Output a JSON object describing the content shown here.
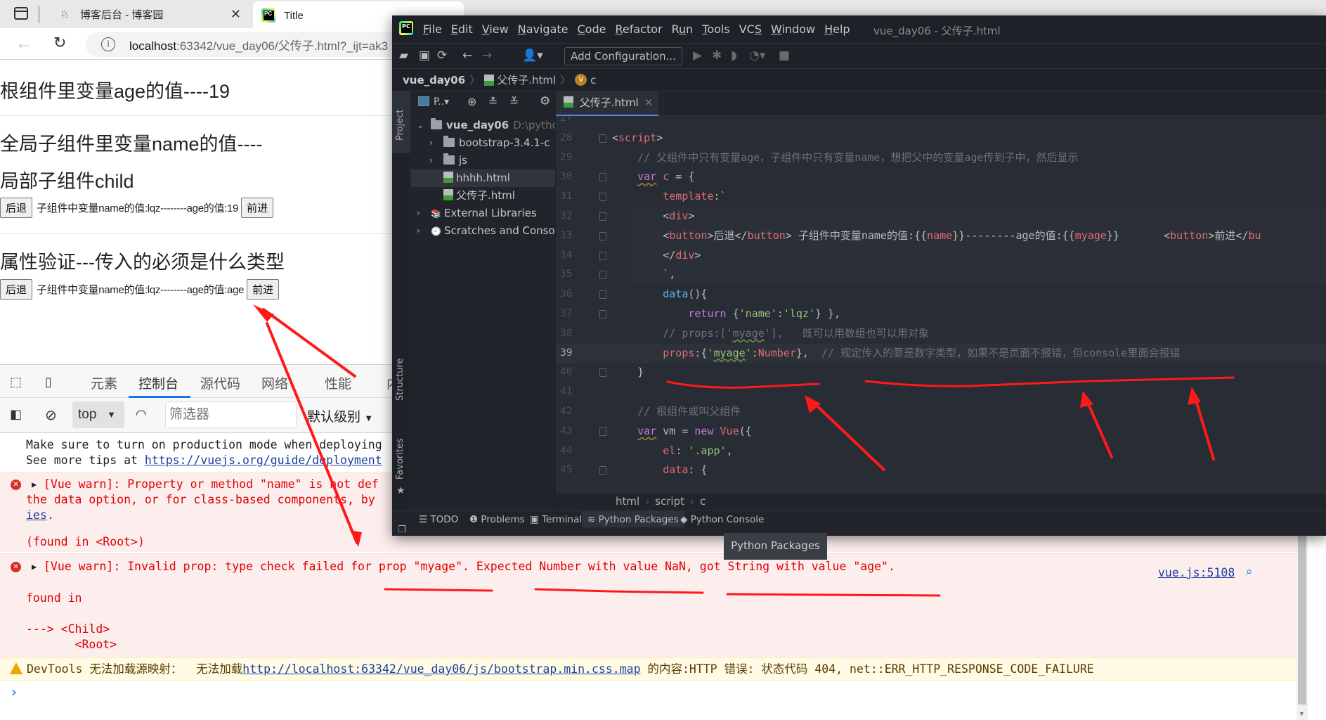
{
  "browser": {
    "tabs": [
      {
        "title": "博客后台 - 博客园",
        "icon": "cnblogs-icon",
        "active": false
      },
      {
        "title": "Title",
        "icon": "pycharm-icon",
        "active": true
      }
    ],
    "url_host": "localhost",
    "url_rest": ":63342/vue_day06/父传子.html?_ijt=ak3"
  },
  "page": {
    "heading_root": "根组件里变量age的值----19",
    "heading_global": "全局子组件里变量name的值----",
    "heading_local": "局部子组件child",
    "row1": {
      "back": "后退",
      "text": "子组件中变量name的值:lqz--------age的值:19",
      "forward": "前进"
    },
    "heading_validation": "属性验证---传入的必须是什么类型",
    "row2": {
      "back": "后退",
      "text": "子组件中变量name的值:lqz--------age的值:age",
      "forward": "前进"
    }
  },
  "devtools": {
    "tabs": [
      "元素",
      "控制台",
      "源代码",
      "网络",
      "性能",
      "内"
    ],
    "active_tab": "控制台",
    "context": "top",
    "filter_placeholder": "筛选器",
    "level": "默认级别",
    "console": {
      "info_line1": "Make sure to turn on production mode when deploying",
      "info_line2_prefix": "See more tips at ",
      "info_line2_link": "https://vuejs.org/guide/deployment",
      "err1_line1": "[Vue warn]: Property or method \"name\" is not def",
      "err1_line2": "the data option, or for class-based components, by",
      "err1_line3": "ies",
      "err1_line3_suffix": ".",
      "err1_found": "(found in <Root>)",
      "err2_line1": "[Vue warn]: Invalid prop: type check failed for prop \"myage\". Expected Number with value NaN, got String with value \"age\".",
      "err2_source": "vue.js:5108",
      "err2_found": "found in",
      "err2_child": "---> <Child>",
      "err2_root": "       <Root>",
      "warn_prefix": "DevTools 无法加载源映射：  无法加载",
      "warn_link": "http://localhost:63342/vue_day06/js/bootstrap.min.css.map",
      "warn_suffix": " 的内容:HTTP 错误: 状态代码 404, net::ERR_HTTP_RESPONSE_CODE_FAILURE",
      "prompt": "›"
    }
  },
  "ide": {
    "menu": [
      {
        "pre": "",
        "u": "F",
        "post": "ile"
      },
      {
        "pre": "",
        "u": "E",
        "post": "dit"
      },
      {
        "pre": "",
        "u": "V",
        "post": "iew"
      },
      {
        "pre": "",
        "u": "N",
        "post": "avigate"
      },
      {
        "pre": "",
        "u": "C",
        "post": "ode"
      },
      {
        "pre": "",
        "u": "R",
        "post": "efactor"
      },
      {
        "pre": "R",
        "u": "u",
        "post": "n"
      },
      {
        "pre": "",
        "u": "T",
        "post": "ools"
      },
      {
        "pre": "VC",
        "u": "S",
        "post": ""
      },
      {
        "pre": "",
        "u": "W",
        "post": "indow"
      },
      {
        "pre": "",
        "u": "H",
        "post": "elp"
      }
    ],
    "title": "vue_day06 - 父传子.html",
    "add_configuration": "Add Configuration...",
    "nav": {
      "project": "vue_day06",
      "file": "父传子.html",
      "symbol": "c"
    },
    "strip": {
      "project": "Project",
      "structure": "Structure",
      "favorites": "Favorites"
    },
    "project_header": "P..",
    "tree": [
      {
        "label": "vue_day06",
        "extra": "D:\\pytho",
        "type": "folder",
        "expanded": true
      },
      {
        "label": "bootstrap-3.4.1-c",
        "type": "folder",
        "expanded": false
      },
      {
        "label": "js",
        "type": "folder",
        "expanded": false
      },
      {
        "label": "hhhh.html",
        "type": "html",
        "selected": true
      },
      {
        "label": "父传子.html",
        "type": "html"
      },
      {
        "label": "External Libraries",
        "type": "lib",
        "expanded": false
      },
      {
        "label": "Scratches and Conso",
        "type": "scratch",
        "expanded": false
      }
    ],
    "editor_tab": "父传子.html",
    "current_line": 39,
    "code": [
      {
        "n": 27,
        "tokens": []
      },
      {
        "n": 28,
        "tokens": [
          [
            "t-punc",
            "<"
          ],
          [
            "t-tag",
            "script"
          ],
          [
            "t-punc",
            ">"
          ]
        ]
      },
      {
        "n": 29,
        "tokens": [
          [
            "t-cmt",
            "    // 父组件中只有变量age，子组件中只有变量name，想把父中的变量age传到子中，然后显示"
          ]
        ]
      },
      {
        "n": 30,
        "tokens": [
          [
            "t-mute",
            "    "
          ],
          [
            "t-kwu",
            "var"
          ],
          [
            "t-var",
            " c"
          ],
          [
            "t-punc",
            " = {"
          ]
        ]
      },
      {
        "n": 31,
        "tokens": [
          [
            "t-mute",
            "        "
          ],
          [
            "t-prop",
            "template"
          ],
          [
            "t-punc",
            ":"
          ],
          [
            "t-str",
            "`"
          ]
        ]
      },
      {
        "n": 32,
        "tokens": [
          [
            "t-mute",
            "        "
          ],
          [
            "t-punc",
            "<"
          ],
          [
            "t-tag",
            "div"
          ],
          [
            "t-punc",
            ">"
          ]
        ]
      },
      {
        "n": 33,
        "tokens": [
          [
            "t-mute",
            "        "
          ],
          [
            "t-punc",
            "<"
          ],
          [
            "t-tag",
            "button"
          ],
          [
            "t-punc",
            ">"
          ],
          [
            "t-mute",
            "后退"
          ],
          [
            "t-punc",
            "</"
          ],
          [
            "t-tag",
            "button"
          ],
          [
            "t-punc",
            ">"
          ],
          [
            "t-mute",
            " 子组件中变量name的值:"
          ],
          [
            "t-punc",
            "{{"
          ],
          [
            "t-tag",
            "name"
          ],
          [
            "t-punc",
            "}}"
          ],
          [
            "t-mute",
            "--------age的值:"
          ],
          [
            "t-punc",
            "{{"
          ],
          [
            "t-tag",
            "myage"
          ],
          [
            "t-punc",
            "}}"
          ],
          [
            "t-mute",
            "       "
          ],
          [
            "t-punc",
            "<"
          ],
          [
            "t-tag",
            "button"
          ],
          [
            "t-punc",
            ">"
          ],
          [
            "t-mute",
            "前进"
          ],
          [
            "t-punc",
            "</"
          ],
          [
            "t-tag",
            "bu"
          ]
        ]
      },
      {
        "n": 34,
        "tokens": [
          [
            "t-mute",
            "        "
          ],
          [
            "t-punc",
            "</"
          ],
          [
            "t-tag",
            "div"
          ],
          [
            "t-punc",
            ">"
          ]
        ]
      },
      {
        "n": 35,
        "tokens": [
          [
            "t-mute",
            "        "
          ],
          [
            "t-str",
            "`"
          ],
          [
            "t-punc",
            ","
          ]
        ]
      },
      {
        "n": 36,
        "tokens": [
          [
            "t-mute",
            "        "
          ],
          [
            "t-fn",
            "data"
          ],
          [
            "t-punc",
            "(){"
          ]
        ]
      },
      {
        "n": 37,
        "tokens": [
          [
            "t-mute",
            "            "
          ],
          [
            "t-kw",
            "return"
          ],
          [
            "t-punc",
            " {"
          ],
          [
            "t-str",
            "'name'"
          ],
          [
            "t-punc",
            ":"
          ],
          [
            "t-str",
            "'lqz'"
          ],
          [
            "t-punc",
            "} },"
          ]
        ]
      },
      {
        "n": 38,
        "tokens": [
          [
            "t-cmt",
            "        // props:['"
          ],
          [
            "t-cmt u-green",
            "myage"
          ],
          [
            "t-cmt",
            "'],   既可以用数组也可以用对象"
          ]
        ]
      },
      {
        "n": 39,
        "tokens": [
          [
            "t-mute",
            "        "
          ],
          [
            "t-prop",
            "props"
          ],
          [
            "t-punc",
            ":{"
          ],
          [
            "t-str",
            "'"
          ],
          [
            "t-str u-green",
            "myage"
          ],
          [
            "t-str",
            "'"
          ],
          [
            "t-punc",
            ":"
          ],
          [
            "t-var",
            "Number"
          ],
          [
            "t-punc",
            "},"
          ],
          [
            "t-cmt",
            "  // 规定传入的要是数字类型，如果不是页面不报错，但console里面会报错"
          ]
        ]
      },
      {
        "n": 40,
        "tokens": [
          [
            "t-mute",
            "    "
          ],
          [
            "t-punc",
            "}"
          ]
        ]
      },
      {
        "n": 41,
        "tokens": []
      },
      {
        "n": 42,
        "tokens": [
          [
            "t-cmt",
            "    // 根组件或叫父组件"
          ]
        ]
      },
      {
        "n": 43,
        "tokens": [
          [
            "t-mute",
            "    "
          ],
          [
            "t-kwu",
            "var"
          ],
          [
            "t-mute",
            " vm = "
          ],
          [
            "t-kw",
            "new"
          ],
          [
            "t-var",
            " Vue"
          ],
          [
            "t-punc",
            "({"
          ]
        ]
      },
      {
        "n": 44,
        "tokens": [
          [
            "t-mute",
            "        "
          ],
          [
            "t-prop",
            "el"
          ],
          [
            "t-punc",
            ": "
          ],
          [
            "t-str",
            "'.app'"
          ],
          [
            "t-punc",
            ","
          ]
        ]
      },
      {
        "n": 45,
        "tokens": [
          [
            "t-mute",
            "        "
          ],
          [
            "t-prop",
            "data"
          ],
          [
            "t-punc",
            ": {"
          ]
        ]
      }
    ],
    "breadcrumbs": [
      "html",
      "script",
      "c"
    ],
    "bottom_tabs": [
      {
        "icon": "list-icon",
        "label": "TODO"
      },
      {
        "icon": "problems-icon",
        "label": "Problems"
      },
      {
        "icon": "terminal-icon",
        "label": "Terminal"
      },
      {
        "icon": "layers-icon",
        "label": "Python Packages",
        "active": true
      },
      {
        "icon": "python-icon",
        "label": "Python Console"
      }
    ],
    "tooltip": "Python Packages"
  },
  "colors": {
    "annotation_red": "#ff1a1a",
    "ide_bg": "#282c34",
    "error_red": "#e00000",
    "link_blue": "#1a3fa0"
  }
}
